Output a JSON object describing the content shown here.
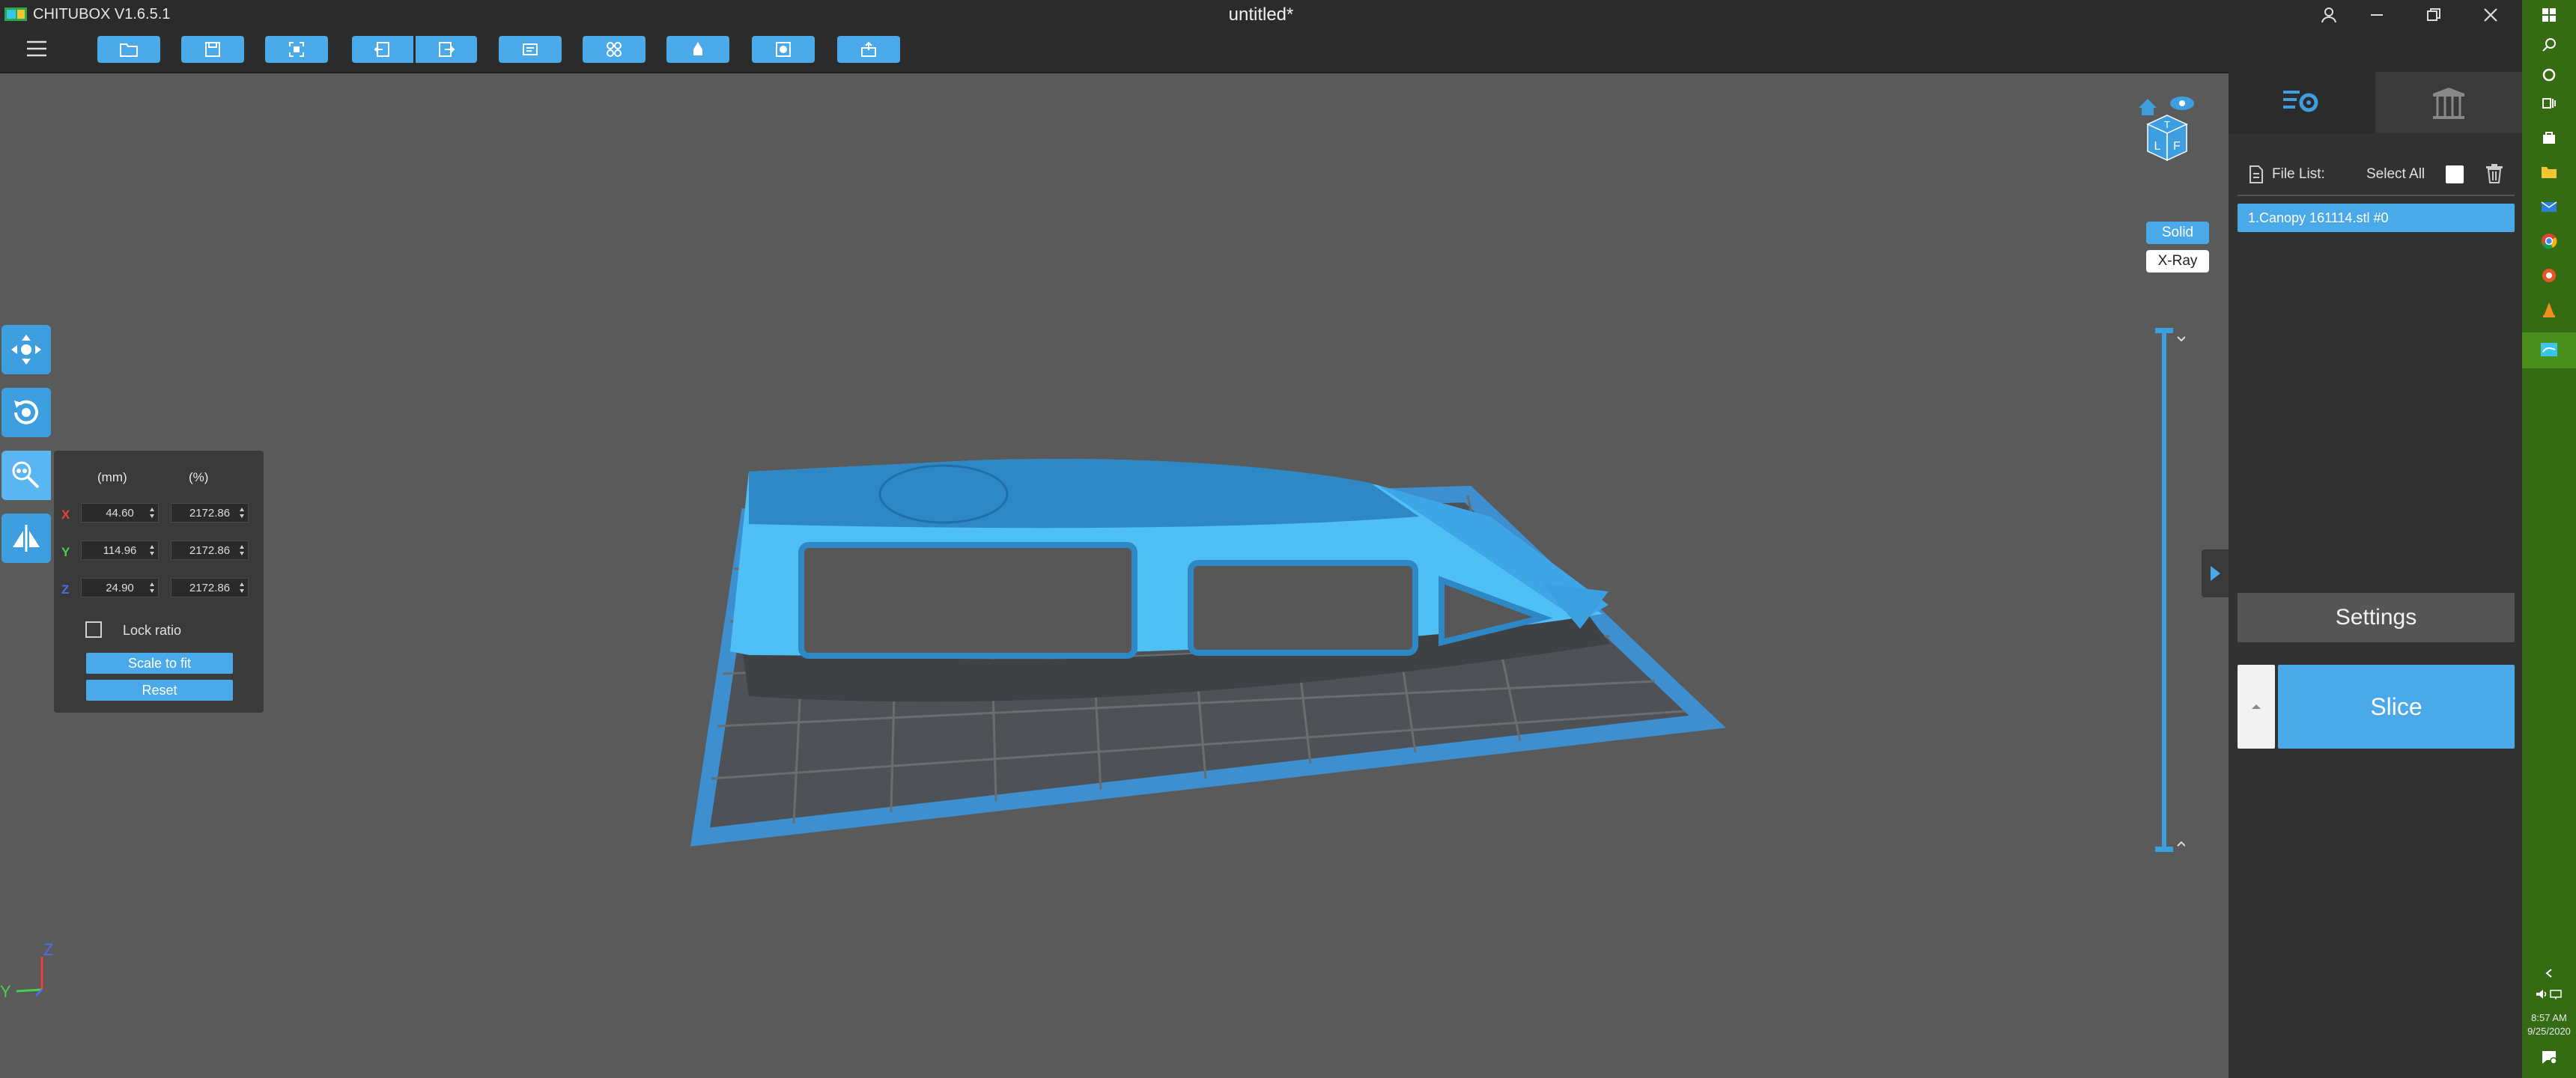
{
  "app": {
    "name": "CHITUBOX V1.6.5.1",
    "window_title": "untitled*"
  },
  "toolbar": {
    "buttons": [
      "open-file-icon",
      "save-icon",
      "screenshot-icon",
      "undo-icon",
      "redo-icon",
      "duplicate-icon",
      "arrange-icon",
      "hollow-icon",
      "dig-hole-icon",
      "export-icon"
    ]
  },
  "scale_panel": {
    "unit_mm": "(mm)",
    "unit_percent": "(%)",
    "rows": [
      {
        "axis": "X",
        "mm": "44.60",
        "percent": "2172.86"
      },
      {
        "axis": "Y",
        "mm": "114.96",
        "percent": "2172.86"
      },
      {
        "axis": "Z",
        "mm": "24.90",
        "percent": "2172.86"
      }
    ],
    "lock_ratio": "Lock ratio",
    "scale_to_fit": "Scale to fit",
    "reset": "Reset"
  },
  "view_modes": {
    "solid": "Solid",
    "xray": "X-Ray"
  },
  "view_cube": {
    "top": "T",
    "left": "L",
    "front": "F"
  },
  "axes": {
    "z": "Z",
    "y": "Y"
  },
  "right_panel": {
    "file_list_label": "File List:",
    "select_all_label": "Select All",
    "files": [
      "1.Canopy 161114.stl #0"
    ],
    "settings": "Settings",
    "slice": "Slice"
  },
  "taskbar": {
    "time": "8:57 AM",
    "date": "9/25/2020"
  },
  "colors": {
    "accent": "#4aa9e8",
    "model": "#3d9fe0",
    "viewport": "#5a5a5a",
    "taskbar": "#356b12"
  }
}
